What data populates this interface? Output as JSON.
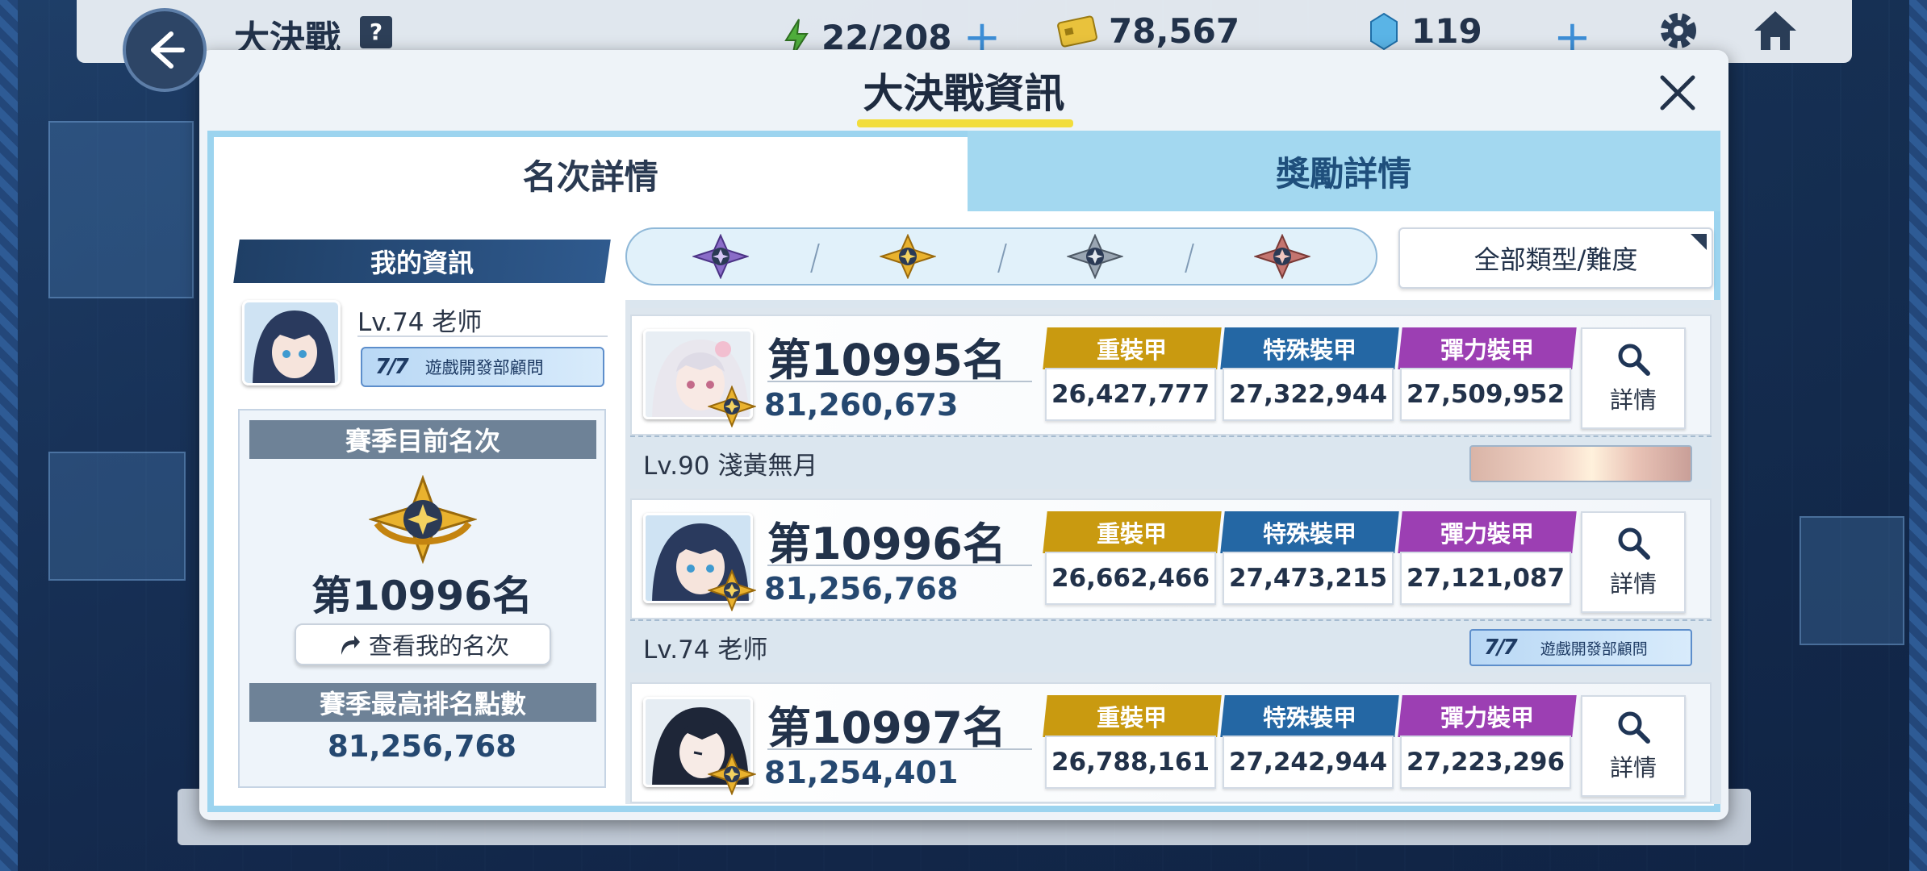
{
  "topbar": {
    "title": "大決戰",
    "help_icon": "question-mark-icon",
    "ap": "22/208",
    "credits": "78,567",
    "pyroxene": "119"
  },
  "modal": {
    "title": "大決戰資訊",
    "tabs": [
      {
        "label": "名次詳情",
        "active": true
      },
      {
        "label": "獎勵詳情",
        "active": false
      }
    ]
  },
  "my_info": {
    "header": "我的資訊",
    "level": "Lv.74 老师",
    "badge": "遊戲開發部顧問",
    "season_rank_label": "賽季目前名次",
    "season_rank": "第10996名",
    "view_rank_button": "查看我的名次",
    "season_best_label": "賽季最高排名點數",
    "season_best": "81,256,768"
  },
  "filter": {
    "tiers": [
      "platinum-tier-emblem",
      "gold-tier-emblem",
      "silver-tier-emblem",
      "bronze-tier-emblem"
    ],
    "type_select": "全部類型/難度"
  },
  "armor_labels": {
    "heavy": "重裝甲",
    "special": "特殊裝甲",
    "elastic": "彈力裝甲",
    "detail": "詳情"
  },
  "rankings": [
    {
      "rank": "第10995名",
      "score": "81,260,673",
      "heavy": "26,427,777",
      "special": "27,322,944",
      "elastic": "27,509,952",
      "level": "Lv.90 淺黃無月",
      "banner": ""
    },
    {
      "rank": "第10996名",
      "score": "81,256,768",
      "heavy": "26,662,466",
      "special": "27,473,215",
      "elastic": "27,121,087",
      "level": "Lv.74 老师",
      "banner": "遊戲開發部顧問"
    },
    {
      "rank": "第10997名",
      "score": "81,254,401",
      "heavy": "26,788,161",
      "special": "27,242,944",
      "elastic": "27,223,296",
      "level": "",
      "banner": ""
    }
  ],
  "colors": {
    "heavy": "#c99a10",
    "special": "#2467a4",
    "elastic": "#9c3fb3",
    "title_underline": "#f2dd3c"
  }
}
